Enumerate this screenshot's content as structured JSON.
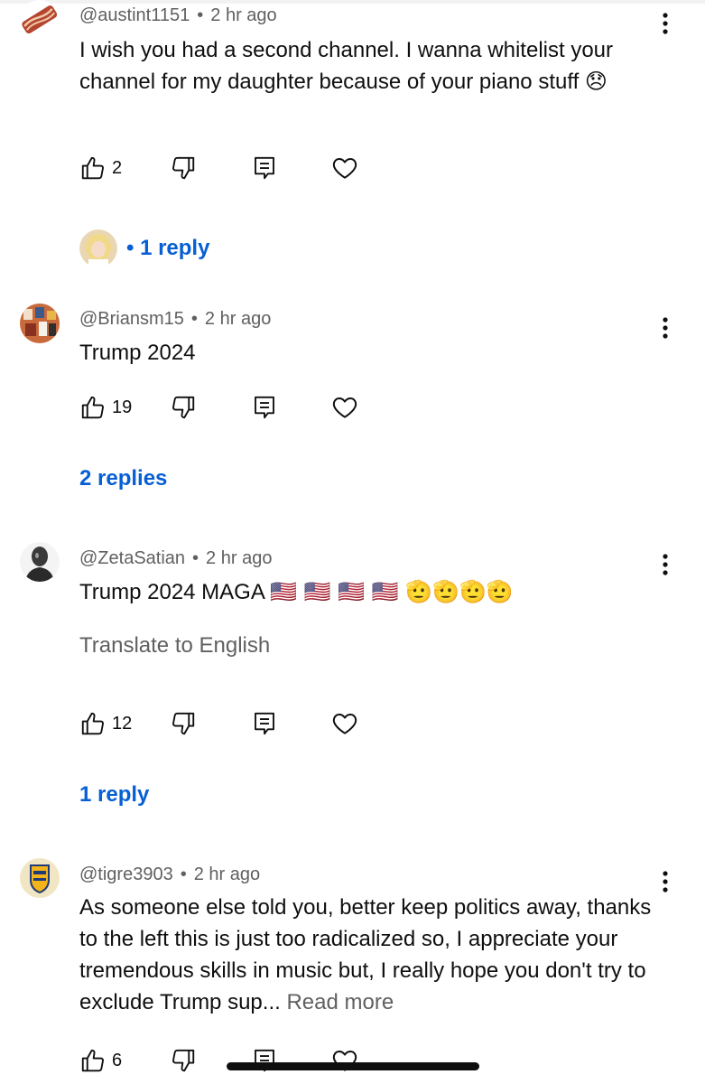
{
  "comments": [
    {
      "author": "@austint1151",
      "separator": "•",
      "time": "2 hr ago",
      "text": "I wish you had a second channel. I wanna whitelist your channel for my daughter because of your piano stuff",
      "emoji": "😞",
      "likes": "2",
      "replies_label": "• 1 reply",
      "avatar_icon": "bacon-avatar",
      "reply_avatar_icon": "blonde-person-avatar"
    },
    {
      "author": "@Briansm15",
      "separator": "•",
      "time": "2 hr ago",
      "text": "Trump 2024",
      "likes": "19",
      "replies_label": "2 replies",
      "avatar_icon": "collage-avatar"
    },
    {
      "author": "@ZetaSatian",
      "separator": "•",
      "time": "2 hr ago",
      "text": "Trump 2024 MAGA",
      "emoji": "🇺🇸 🇺🇸 🇺🇸 🇺🇸 🫡🫡🫡🫡",
      "translate": "Translate to English",
      "likes": "12",
      "replies_label": "1 reply",
      "avatar_icon": "statue-avatar"
    },
    {
      "author": "@tigre3903",
      "separator": "•",
      "time": "2 hr ago",
      "text": "As someone else told you, better keep politics away, thanks to the left this is just too radicalized so, I appreciate your tremendous skills in music but, I really hope you don't try to exclude Trump sup...",
      "read_more": "Read more",
      "likes": "6",
      "avatar_icon": "tigres-crest-avatar"
    }
  ],
  "colors": {
    "link_blue": "#065fd4",
    "meta_gray": "#606060",
    "text": "#0f0f0f"
  }
}
